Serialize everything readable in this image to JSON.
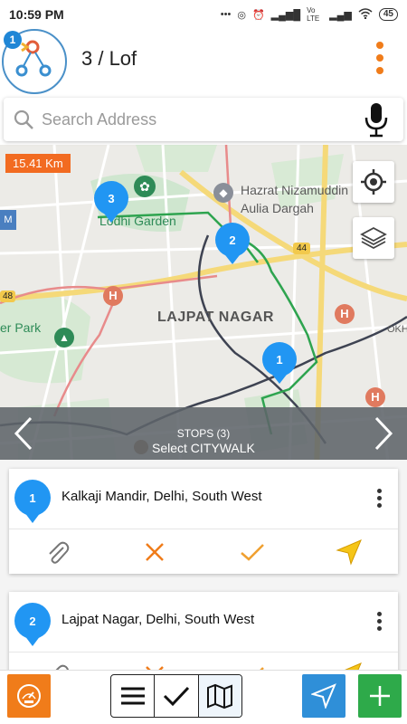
{
  "status": {
    "time": "10:59 PM",
    "battery": "45",
    "network": "Vo LTE"
  },
  "header": {
    "badge": "1",
    "title": "3 / Lof"
  },
  "search": {
    "placeholder": "Search Address"
  },
  "map": {
    "distance": "15.41 Km",
    "labels": {
      "hazrat": "Hazrat Nizamuddin",
      "aulia": "Aulia Dargah",
      "lodhi": "Lodhi Garden",
      "lajpat": "LAJPAT NAGAR",
      "park": "er Park",
      "okh": "OKH",
      "hwy44": "44",
      "hwy48": "48",
      "citywalk": "Select CITYWALK"
    },
    "pins": [
      {
        "number": "3"
      },
      {
        "number": "2"
      },
      {
        "number": "1"
      }
    ],
    "route_color": "#2ea44f",
    "pin_color": "#2196f3"
  },
  "stops_bar": {
    "label": "STOPS (3)"
  },
  "stops": [
    {
      "number": "1",
      "name": "Kalkaji Mandir,  Delhi,  South West"
    },
    {
      "number": "2",
      "name": "Lajpat Nagar, Delhi, South West"
    }
  ],
  "colors": {
    "accent": "#f07c1a",
    "primary": "#1f86d6",
    "success": "#2eaa4a"
  },
  "toolbar": {
    "icons": [
      "speedometer-icon",
      "list-icon",
      "check-icon",
      "map-icon",
      "navigate-icon",
      "plus-icon"
    ]
  }
}
